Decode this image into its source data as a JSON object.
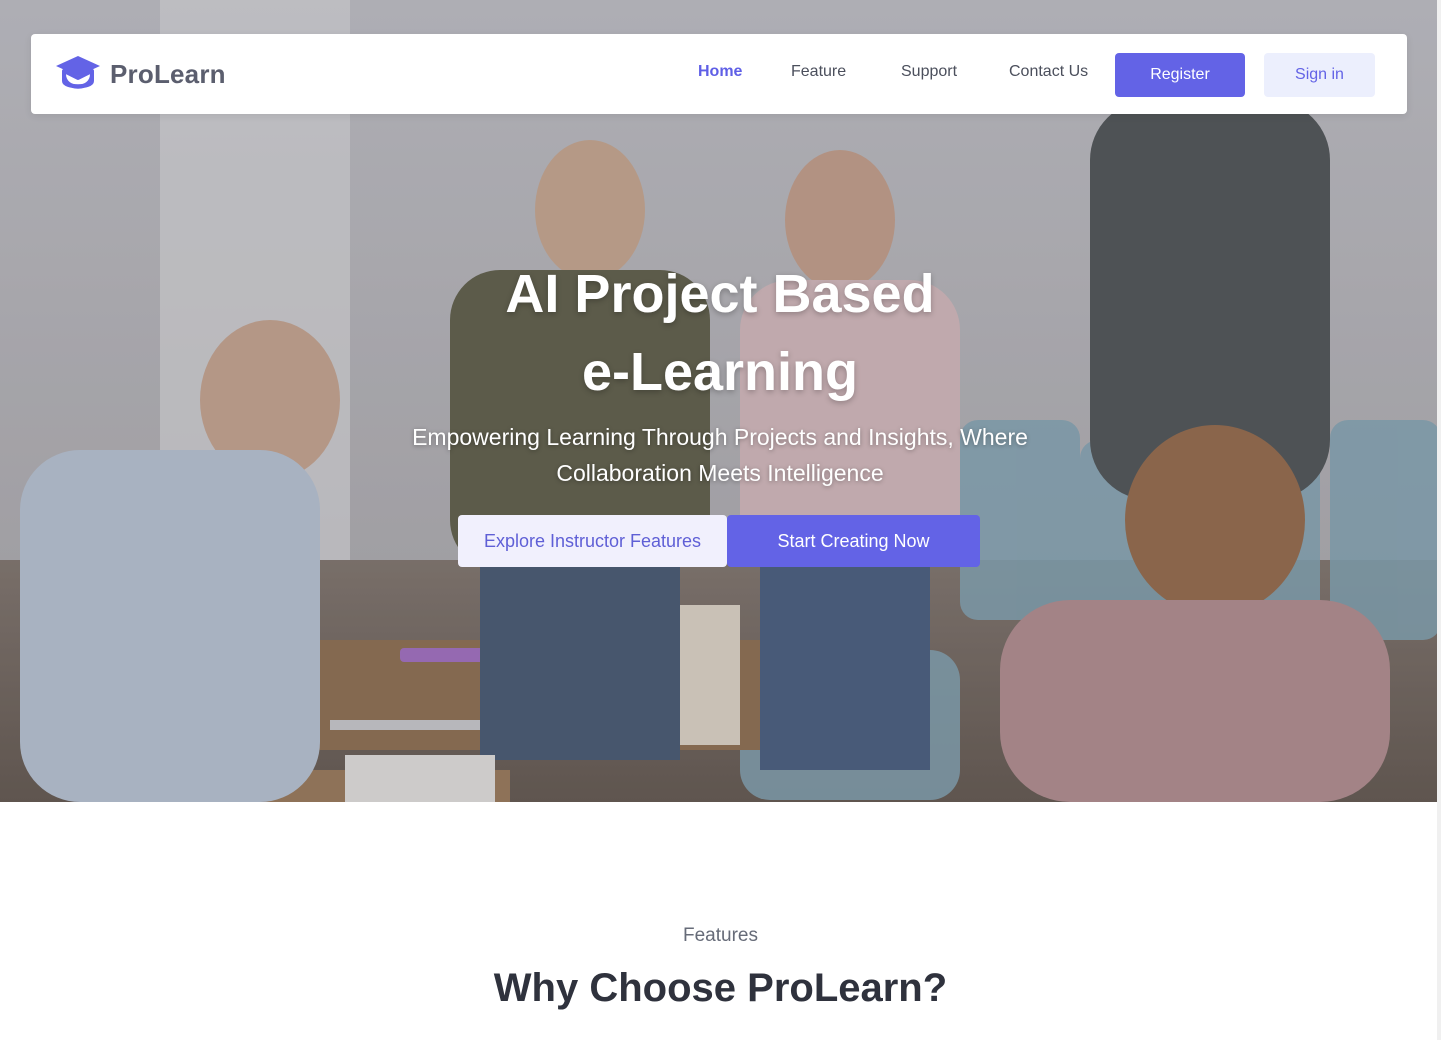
{
  "brand": {
    "name": "ProLearn",
    "icon": "graduation-cap-icon",
    "accent": "#6363e6"
  },
  "nav": {
    "links": [
      {
        "label": "Home",
        "active": true
      },
      {
        "label": "Feature",
        "active": false
      },
      {
        "label": "Support",
        "active": false
      },
      {
        "label": "Contact Us",
        "active": false
      }
    ],
    "register_label": "Register",
    "signin_label": "Sign in"
  },
  "hero": {
    "title_line1": "AI Project Based",
    "title_line2": "e-Learning",
    "subtitle_line1": "Empowering Learning Through Projects and Insights, Where",
    "subtitle_line2": "Collaboration Meets Intelligence",
    "explore_label": "Explore Instructor Features",
    "start_label": "Start Creating Now"
  },
  "features": {
    "eyebrow": "Features",
    "title": "Why Choose ProLearn?"
  },
  "colors": {
    "primary": "#6363e6",
    "primary_light": "#eceffd",
    "heading": "#2f323d",
    "muted": "#666b78"
  }
}
